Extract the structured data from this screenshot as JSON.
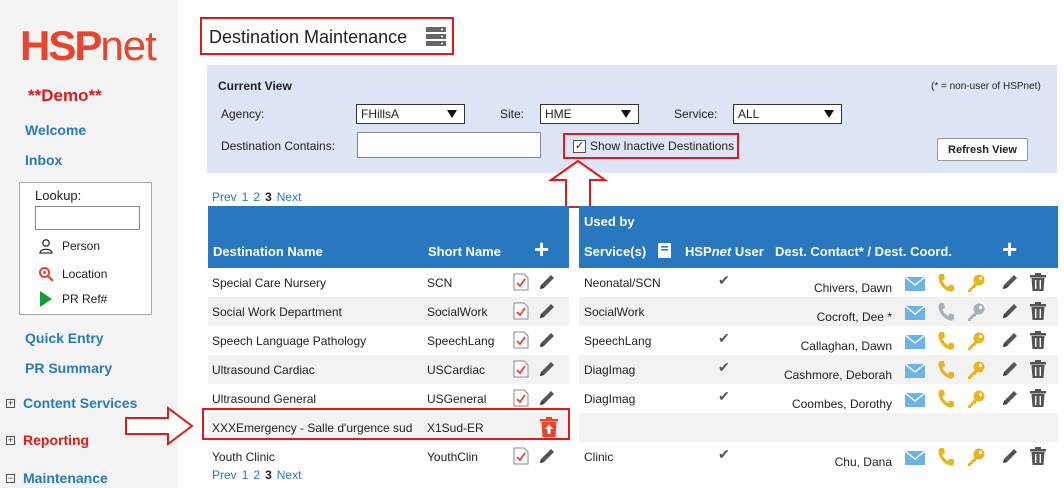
{
  "logo": {
    "hsp": "HSP",
    "net": "net"
  },
  "demo": "**Demo**",
  "nav": {
    "welcome": "Welcome",
    "inbox": "Inbox",
    "quick_entry": "Quick Entry",
    "pr_summary": "PR Summary"
  },
  "lookup": {
    "title": "Lookup:",
    "person": "Person",
    "location": "Location",
    "pr_ref": "PR Ref#"
  },
  "sections": {
    "content_services": "Content Services",
    "reporting": "Reporting",
    "maintenance": "Maintenance"
  },
  "page_title": "Destination Maintenance",
  "current_view": {
    "title": "Current View",
    "note": "(* = non-user of HSPnet)",
    "agency_label": "Agency:",
    "agency_value": "FHillsA",
    "site_label": "Site:",
    "site_value": "HME",
    "service_label": "Service:",
    "service_value": "ALL",
    "dest_contains_label": "Destination Contains:",
    "dest_contains_value": "",
    "show_inactive_label": "Show Inactive Destinations",
    "refresh_label": "Refresh View"
  },
  "pager": {
    "prev": "Prev",
    "pages": [
      "1",
      "2",
      "3"
    ],
    "current": "3",
    "next": "Next"
  },
  "left_table": {
    "col_name": "Destination Name",
    "col_short": "Short Name",
    "add": "+"
  },
  "right_table": {
    "used_by": "Used by",
    "col_services": "Service(s)",
    "col_hsp_a": "HSP",
    "col_hsp_b": "net",
    "col_hsp_c": " User",
    "col_contact": "Dest. Contact* / Dest. Coord.",
    "add": "+"
  },
  "rows": [
    {
      "name": "Special Care Nursery",
      "short": "SCN",
      "service": "Neonatal/SCN",
      "user": true,
      "contact": "Chivers, Dawn",
      "key_active": true,
      "inactive": false
    },
    {
      "name": "Social Work Department",
      "short": "SocialWork",
      "service": "SocialWork",
      "user": false,
      "contact": "Cocroft, Dee *",
      "key_active": false,
      "inactive": false
    },
    {
      "name": "Speech Language Pathology",
      "short": "SpeechLang",
      "service": "SpeechLang",
      "user": true,
      "contact": "Callaghan, Dawn",
      "key_active": true,
      "inactive": false
    },
    {
      "name": "Ultrasound Cardiac",
      "short": "USCardiac",
      "service": "DiagImag",
      "user": true,
      "contact": "Cashmore, Deborah",
      "key_active": true,
      "inactive": false
    },
    {
      "name": "Ultrasound General",
      "short": "USGeneral",
      "service": "DiagImag",
      "user": true,
      "contact": "Coombes, Dorothy",
      "key_active": true,
      "inactive": false
    },
    {
      "name": "XXXEmergency - Salle d'urgence sud",
      "short": "X1Sud-ER",
      "service": "",
      "user": false,
      "contact": "",
      "key_active": false,
      "inactive": true
    },
    {
      "name": "Youth Clinic",
      "short": "YouthClin",
      "service": "Clinic",
      "user": true,
      "contact": "Chu, Dana",
      "key_active": true,
      "inactive": false
    }
  ],
  "colors": {
    "header_blue": "#2977bf",
    "link_blue": "#2a7ab8",
    "highlight_red": "#e01919",
    "row_alt": "#f2f2f2"
  }
}
